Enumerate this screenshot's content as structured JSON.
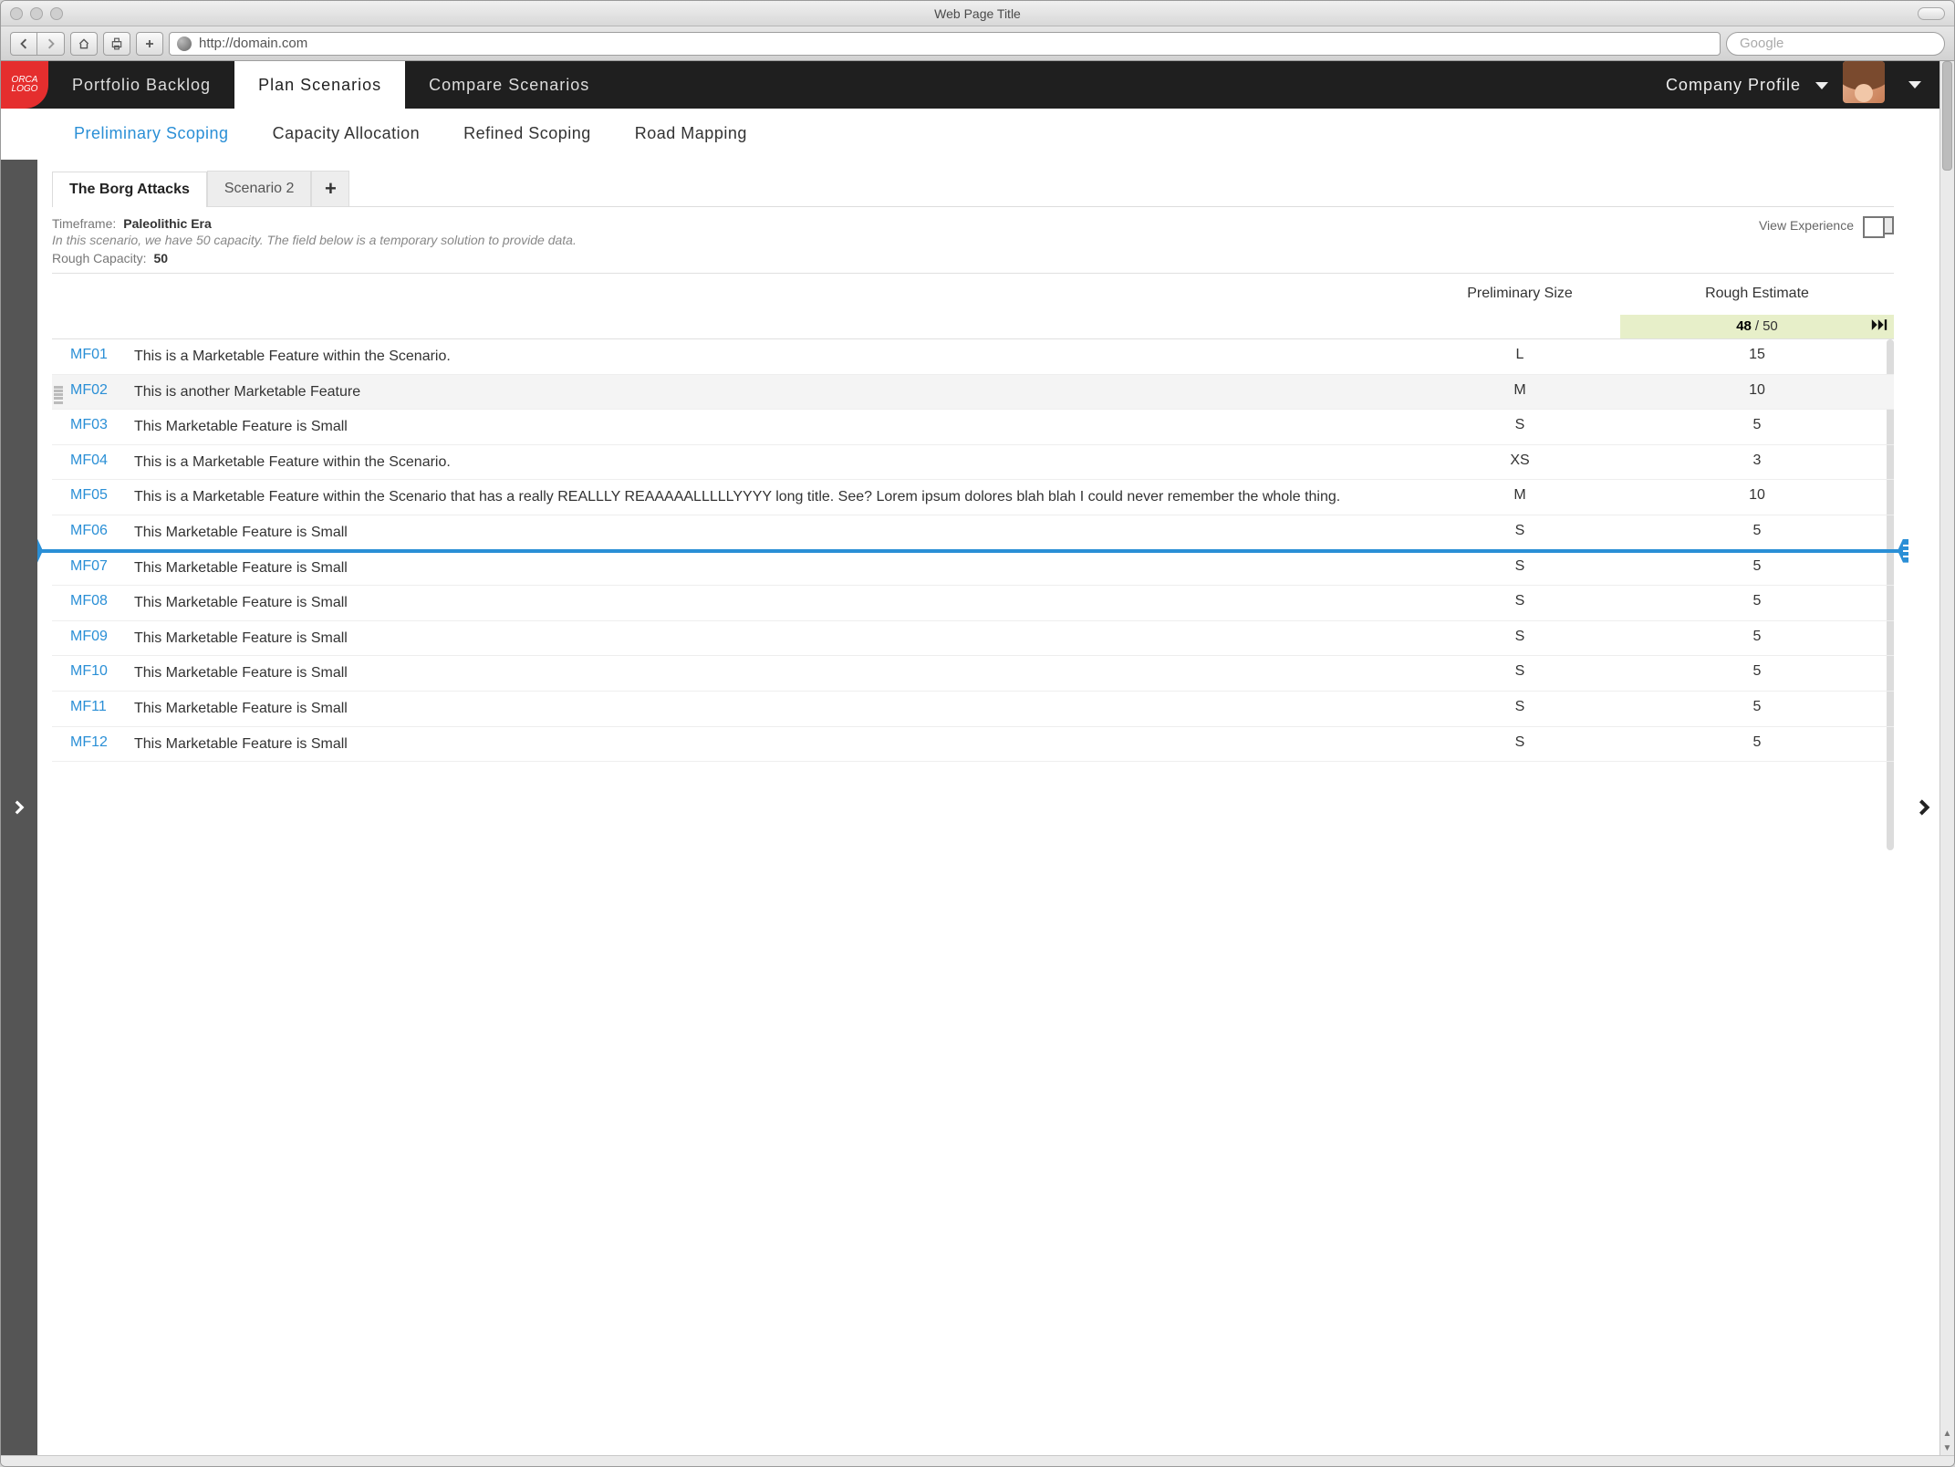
{
  "browser": {
    "window_title": "Web Page Title",
    "url": "http://domain.com",
    "search_placeholder": "Google"
  },
  "app": {
    "logo_text": "ORCA LOGO",
    "top_nav": {
      "items": [
        "Portfolio Backlog",
        "Plan Scenarios",
        "Compare Scenarios"
      ],
      "active_index": 1,
      "profile_label": "Company Profile"
    },
    "sub_nav": {
      "items": [
        "Preliminary Scoping",
        "Capacity Allocation",
        "Refined Scoping",
        "Road Mapping"
      ],
      "active_index": 0
    },
    "scenario_tabs": {
      "items": [
        "The Borg Attacks",
        "Scenario 2"
      ],
      "active_index": 0,
      "add_label": "+"
    },
    "meta": {
      "timeframe_label": "Timeframe:",
      "timeframe_value": "Paleolithic Era",
      "description": "In this scenario, we have 50 capacity. The field below is a temporary solution to provide data.",
      "rough_capacity_label": "Rough Capacity:",
      "rough_capacity_value": "50",
      "view_experience_label": "View Experience"
    },
    "table": {
      "columns": {
        "size": "Preliminary Size",
        "estimate": "Rough Estimate"
      },
      "estimate_used": "48",
      "estimate_sep": "/",
      "estimate_total": "50",
      "insertion_after_index": 5,
      "hover_index": 1,
      "rows": [
        {
          "id": "MF01",
          "title": "This is a Marketable Feature within the Scenario.",
          "size": "L",
          "estimate": "15"
        },
        {
          "id": "MF02",
          "title": "This is another Marketable Feature",
          "size": "M",
          "estimate": "10"
        },
        {
          "id": "MF03",
          "title": "This Marketable Feature is Small",
          "size": "S",
          "estimate": "5"
        },
        {
          "id": "MF04",
          "title": "This is a Marketable Feature within the Scenario.",
          "size": "XS",
          "estimate": "3"
        },
        {
          "id": "MF05",
          "title": "This is a Marketable Feature within the Scenario that has a really REALLLY REAAAAALLLLLYYYY long title. See? Lorem ipsum dolores blah blah I could never remember the whole thing.",
          "size": "M",
          "estimate": "10"
        },
        {
          "id": "MF06",
          "title": "This Marketable Feature is Small",
          "size": "S",
          "estimate": "5"
        },
        {
          "id": "MF07",
          "title": "This Marketable Feature is Small",
          "size": "S",
          "estimate": "5"
        },
        {
          "id": "MF08",
          "title": "This Marketable Feature is Small",
          "size": "S",
          "estimate": "5"
        },
        {
          "id": "MF09",
          "title": "This Marketable Feature is Small",
          "size": "S",
          "estimate": "5"
        },
        {
          "id": "MF10",
          "title": "This Marketable Feature is Small",
          "size": "S",
          "estimate": "5"
        },
        {
          "id": "MF11",
          "title": "This Marketable Feature is Small",
          "size": "S",
          "estimate": "5"
        },
        {
          "id": "MF12",
          "title": "This Marketable Feature is Small",
          "size": "S",
          "estimate": "5"
        }
      ]
    }
  }
}
